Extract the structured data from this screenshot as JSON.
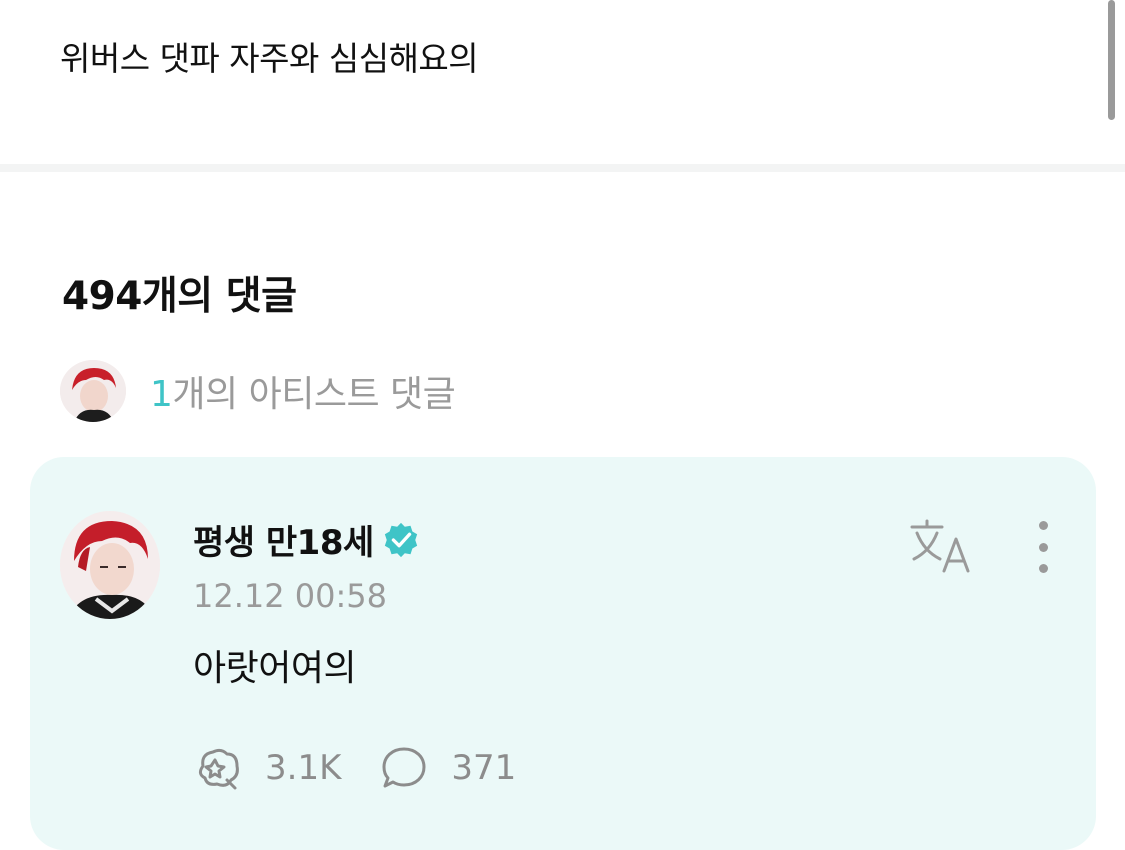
{
  "post": {
    "text": "위버스 댓파 자주와 심심해요의"
  },
  "comments_header": {
    "count_label": "494개의 댓글"
  },
  "artist_comments": {
    "count": "1",
    "label": "개의 아티스트 댓글"
  },
  "comment": {
    "author": "평생 만18세",
    "timestamp": "12.12 00:58",
    "text": "아랏어여의",
    "likes": "3.1K",
    "replies": "371"
  },
  "icons": {
    "verified": "verified-badge-icon",
    "translate": "translate-icon",
    "more": "more-vertical-icon",
    "like": "like-icon",
    "reply": "speech-bubble-icon"
  },
  "colors": {
    "accent": "#3fc4c7",
    "card_background": "#ebf9f8",
    "muted_text": "#9a9a9a"
  }
}
